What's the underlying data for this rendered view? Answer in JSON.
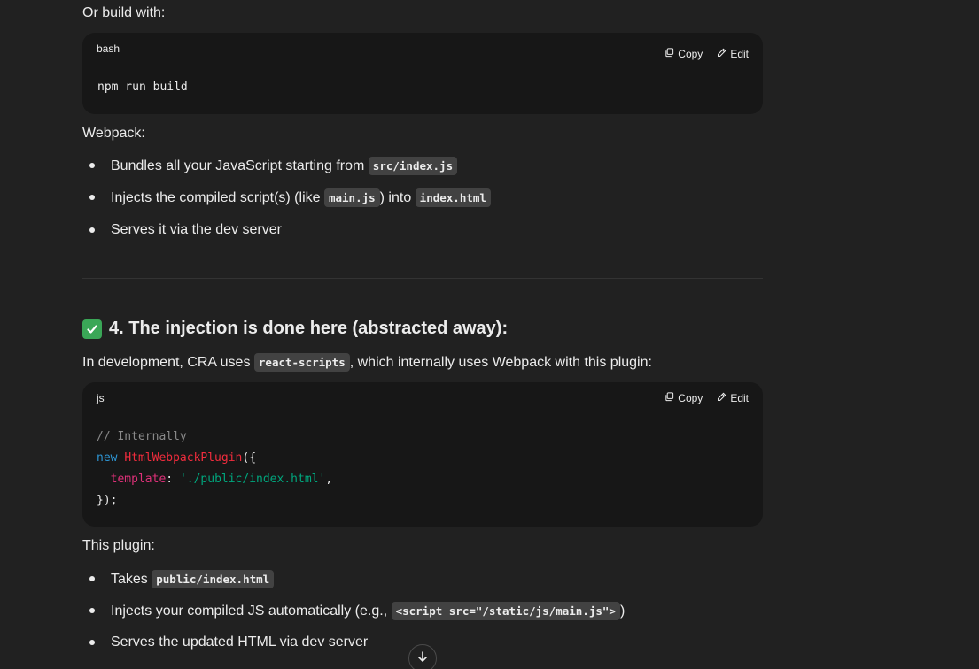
{
  "section1": {
    "intro": "Or build with:",
    "code_lang": "bash",
    "copy_label": "Copy",
    "edit_label": "Edit",
    "code_line": "npm run build"
  },
  "webpack": {
    "label": "Webpack:",
    "items": [
      {
        "text": "Bundles all your JavaScript starting from ",
        "code": "src/index.js"
      },
      {
        "text_a": "Injects the compiled script(s) (like ",
        "code_a": "main.js",
        "text_b": ") into ",
        "code_b": "index.html"
      },
      {
        "text": "Serves it via the dev server"
      }
    ]
  },
  "section4": {
    "heading": "4. The injection is done here (abstracted away):",
    "intro_a": "In development, CRA uses ",
    "intro_code": "react-scripts",
    "intro_b": ", which internally uses Webpack with this plugin:",
    "code_lang": "js",
    "copy_label": "Copy",
    "edit_label": "Edit",
    "code": {
      "comment": "// Internally",
      "kw_new": "new",
      "fn_name": "HtmlWebpackPlugin",
      "open": "({",
      "prop": "template",
      "colon": ": ",
      "str": "'./public/index.html'",
      "comma": ",",
      "close": "});"
    }
  },
  "plugin": {
    "label": "This plugin:",
    "items": [
      {
        "text": "Takes ",
        "code": "public/index.html"
      },
      {
        "text_a": "Injects your compiled JS automatically (e.g., ",
        "code": "<script src=\"/static/js/main.js\">",
        "text_b": ")"
      },
      {
        "text": "Serves the updated HTML via dev server"
      }
    ]
  },
  "colors": {
    "background": "#212121",
    "code_bg": "#171717",
    "inline_code_bg": "#424242",
    "check_green": "#3aa757"
  },
  "icons": {
    "copy": "copy-icon",
    "edit": "pencil-icon",
    "check": "check-mark-icon",
    "scroll": "arrow-down-icon"
  }
}
